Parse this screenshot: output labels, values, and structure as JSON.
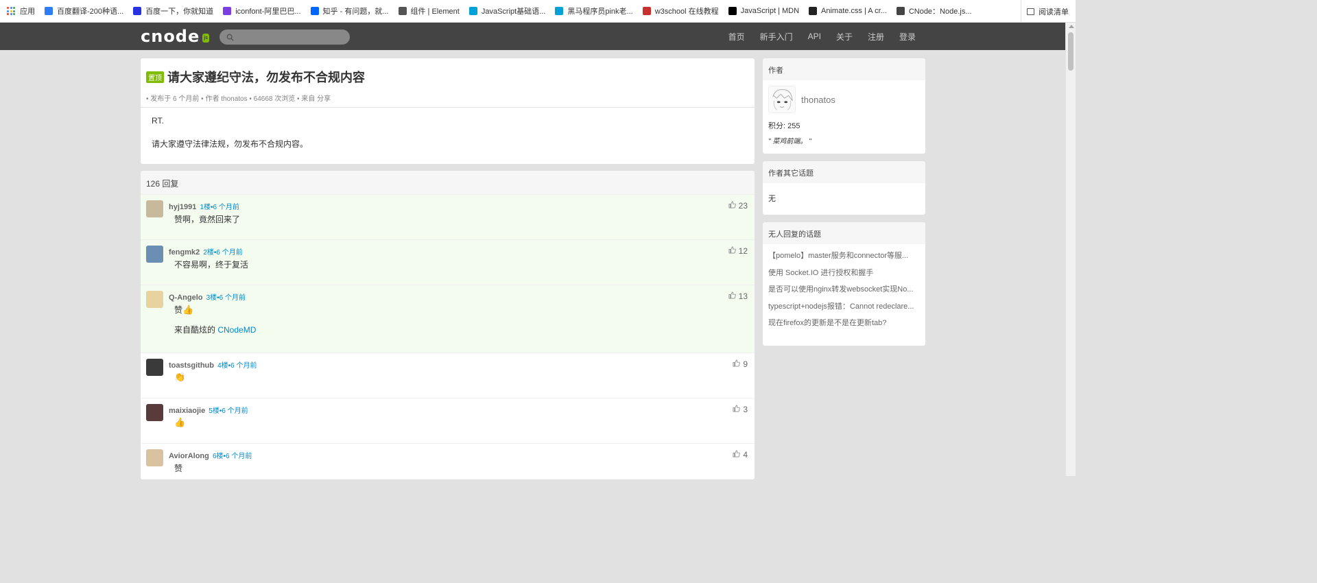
{
  "bookmarks": {
    "apps_label": "应用",
    "items": [
      {
        "label": "百度翻译-200种语...",
        "icon": "baidu-translate-icon",
        "color": "#2e7cf6"
      },
      {
        "label": "百度一下，你就知道",
        "icon": "baidu-paw-icon",
        "color": "#2932e1"
      },
      {
        "label": "iconfont-阿里巴巴...",
        "icon": "iconfont-icon",
        "color": "#7b3fe4"
      },
      {
        "label": "知乎 - 有问题，就...",
        "icon": "zhihu-icon",
        "color": "#0066ff"
      },
      {
        "label": "组件 | Element",
        "icon": "globe-icon",
        "color": "#555555"
      },
      {
        "label": "JavaScript基础语...",
        "icon": "bilibili-icon",
        "color": "#00a1d6"
      },
      {
        "label": "黑马程序员pink老...",
        "icon": "bilibili-icon",
        "color": "#00a1d6"
      },
      {
        "label": "w3school 在线教程",
        "icon": "w3school-icon",
        "color": "#c7322f"
      },
      {
        "label": "JavaScript | MDN",
        "icon": "mdn-icon",
        "color": "#000000"
      },
      {
        "label": "Animate.css | A cr...",
        "icon": "animate-icon",
        "color": "#222222"
      },
      {
        "label": "CNode：Node.js...",
        "icon": "cnode-icon",
        "color": "#444444"
      }
    ],
    "reading_list_label": "阅读清单"
  },
  "navbar": {
    "logo_text": "cnode",
    "logo_badge": "js",
    "search_placeholder": "",
    "links": [
      "首页",
      "新手入门",
      "API",
      "关于",
      "注册",
      "登录"
    ]
  },
  "topic": {
    "tag": "置顶",
    "title": "请大家遵纪守法，勿发布不合规内容",
    "meta": "• 发布于 6 个月前 • 作者 thonatos • 64668 次浏览 • 来自 分享",
    "body_lines": [
      "RT.",
      "请大家遵守法律法规，勿发布不合规内容。"
    ]
  },
  "replies": {
    "count_label": "126 回复",
    "items": [
      {
        "author": "hyj1991",
        "floor": "1楼•6 个月前",
        "content": "赞啊，竟然回来了",
        "likes": "23",
        "highlight": true,
        "avatar_color": "#c9b99c"
      },
      {
        "author": "fengmk2",
        "floor": "2楼•6 个月前",
        "content": "不容易啊，终于复活",
        "likes": "12",
        "highlight": true,
        "avatar_color": "#6b8fb2"
      },
      {
        "author": "Q-Angelo",
        "floor": "3楼•6 个月前",
        "content": "赞",
        "emoji": "👍",
        "extra_prefix": "来自酷炫的 ",
        "extra_link": "CNodeMD",
        "likes": "13",
        "highlight": true,
        "avatar_color": "#e8d3a0"
      },
      {
        "author": "toastsgithub",
        "floor": "4楼•6 个月前",
        "content": "",
        "emoji": "👏",
        "likes": "9",
        "highlight": false,
        "avatar_color": "#3a3a3a"
      },
      {
        "author": "maixiaojie",
        "floor": "5楼•6 个月前",
        "content": "",
        "emoji": "👍",
        "likes": "3",
        "highlight": false,
        "avatar_color": "#5a3b3b"
      },
      {
        "author": "AviorAlong",
        "floor": "6楼•6 个月前",
        "content": "赞",
        "likes": "4",
        "highlight": false,
        "avatar_color": "#d8c2a0"
      }
    ]
  },
  "sidebar": {
    "author_panel": {
      "title": "作者",
      "name": "thonatos",
      "score": "积分: 255",
      "signature": "\" 菜鸡前端。 \""
    },
    "other_topics_panel": {
      "title": "作者其它话题",
      "empty": "无"
    },
    "unanswered_panel": {
      "title": "无人回复的话题",
      "items": [
        "【pomelo】master服务和connector等服...",
        "使用 Socket.IO 进行授权和握手",
        "是否可以使用nginx转发websocket实现No...",
        "typescript+nodejs报错：Cannot redeclare...",
        "现在firefox的更新是不是在更新tab?"
      ]
    }
  }
}
